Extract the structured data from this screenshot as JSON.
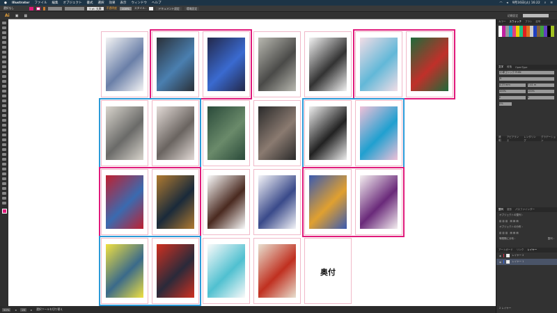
{
  "menubar": {
    "apple": "",
    "app": "Illustrator",
    "items": [
      "ファイル",
      "編集",
      "オブジェクト",
      "書式",
      "選択",
      "効果",
      "表示",
      "ウィンドウ",
      "ヘルプ"
    ],
    "clock": "9月16日(火) 16:22"
  },
  "control": {
    "selection": "選択なし",
    "stroke_style": "5 pt. 丸筆",
    "opacity_label": "不透明度",
    "opacity": "100%",
    "style_label": "スタイル :",
    "doc_settings": "ドキュメント設定",
    "prefs": "環境設定",
    "fill_color": "#e0197a"
  },
  "tabbar": {
    "app_icon": "Ai",
    "workspace": "初期設定",
    "search_placeholder": ""
  },
  "status": {
    "zoom": "50%",
    "artboard": "25",
    "tool": "選択ツールを切り替え"
  },
  "panel": {
    "swatch_tabs": [
      "カラー",
      "スウォッチ",
      "ブラシ",
      "記号"
    ],
    "char_tabs": [
      "文字",
      "段落",
      "OpenType"
    ],
    "font": "小塚ゴシック Pr6N",
    "font_style": "R",
    "size": "4.23 mm",
    "leading": "7.41 m",
    "hscale": "100%",
    "vscale": "100%",
    "kern": "0",
    "track": "0",
    "tsume": "0%",
    "transparency_tabs": [
      "透明",
      "アピアランス",
      "レンダリング",
      "グラデーション"
    ],
    "align_tabs": [
      "整列",
      "変形",
      "パスファインダー"
    ],
    "align_objects": "オブジェクトの整列 :",
    "distribute_objects": "オブジェクトの分布 :",
    "distribute_spacing": "等間隔に分布 :",
    "align_to": "整列 :",
    "layer_tabs": [
      "アートボード",
      "リンク",
      "レイヤー"
    ],
    "layers": [
      {
        "name": "レイヤー 2",
        "color": "#e0304a"
      },
      {
        "name": "レイヤー 1",
        "color": "#3060e0"
      }
    ],
    "layer_count": "2 レイヤー"
  },
  "artboards": [
    {
      "row": 0,
      "col": 0,
      "colors": [
        "#f4f4f4",
        "#6a7fa8"
      ]
    },
    {
      "row": 0,
      "col": 1,
      "colors": [
        "#2a3038",
        "#4a7fb0"
      ]
    },
    {
      "row": 0,
      "col": 2,
      "colors": [
        "#23284a",
        "#3a6ad0"
      ]
    },
    {
      "row": 0,
      "col": 3,
      "colors": [
        "#b8b8b0",
        "#4a4a48"
      ]
    },
    {
      "row": 0,
      "col": 4,
      "colors": [
        "#f2f2f2",
        "#333"
      ]
    },
    {
      "row": 0,
      "col": 5,
      "colors": [
        "#f2dde6",
        "#62b8d8"
      ]
    },
    {
      "row": 0,
      "col": 6,
      "colors": [
        "#1e6a3a",
        "#c0302a"
      ]
    },
    {
      "row": 1,
      "col": 0,
      "colors": [
        "#d8d4cc",
        "#6a6a68"
      ]
    },
    {
      "row": 1,
      "col": 1,
      "colors": [
        "#e2dad6",
        "#6a6460"
      ]
    },
    {
      "row": 1,
      "col": 2,
      "colors": [
        "#2a4a3a",
        "#6a8a6a"
      ]
    },
    {
      "row": 1,
      "col": 3,
      "colors": [
        "#2a2a2a",
        "#8a7a70"
      ]
    },
    {
      "row": 1,
      "col": 4,
      "colors": [
        "#eeeeee",
        "#222"
      ]
    },
    {
      "row": 1,
      "col": 5,
      "colors": [
        "#f0c0d8",
        "#20a0d0"
      ]
    },
    {
      "row": 2,
      "col": 0,
      "colors": [
        "#c02030",
        "#3a6ab0"
      ]
    },
    {
      "row": 2,
      "col": 1,
      "colors": [
        "#b07a30",
        "#1a2a3a"
      ]
    },
    {
      "row": 2,
      "col": 2,
      "colors": [
        "#fafafa",
        "#4a2a20"
      ]
    },
    {
      "row": 2,
      "col": 3,
      "colors": [
        "#f4f4f8",
        "#3a4a8a"
      ]
    },
    {
      "row": 2,
      "col": 4,
      "colors": [
        "#3a5ab0",
        "#e0a030"
      ]
    },
    {
      "row": 2,
      "col": 5,
      "colors": [
        "#f4eef0",
        "#6a2a7a"
      ]
    },
    {
      "row": 3,
      "col": 0,
      "colors": [
        "#f0e040",
        "#3a6a8a"
      ]
    },
    {
      "row": 3,
      "col": 1,
      "colors": [
        "#d03020",
        "#2a2a3a"
      ]
    },
    {
      "row": 3,
      "col": 2,
      "colors": [
        "#fafafa",
        "#50c0d0"
      ]
    },
    {
      "row": 3,
      "col": 3,
      "colors": [
        "#e8e0d0",
        "#c03020"
      ]
    },
    {
      "row": 3,
      "col": 4,
      "colors": [],
      "label": "奥付"
    }
  ],
  "groups": [
    {
      "row": 0,
      "col": 1,
      "color": "#e0197a"
    },
    {
      "row": 0,
      "col": 5,
      "color": "#e0197a"
    },
    {
      "row": 1,
      "col": 0,
      "color": "#2a9ad8"
    },
    {
      "row": 1,
      "col": 4,
      "color": "#2a9ad8"
    },
    {
      "row": 2,
      "col": 0,
      "color": "#e0197a"
    },
    {
      "row": 2,
      "col": 4,
      "color": "#e0197a"
    },
    {
      "row": 3,
      "col": 0,
      "color": "#2a9ad8"
    }
  ]
}
